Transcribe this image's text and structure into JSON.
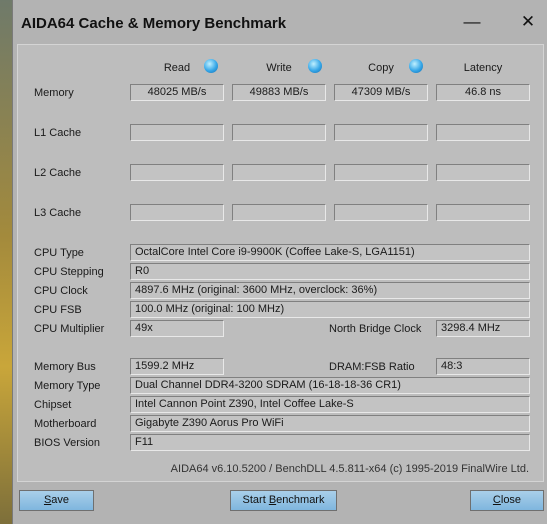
{
  "window": {
    "title": "AIDA64 Cache & Memory Benchmark",
    "minimize_glyph": "—",
    "close_glyph": "✕"
  },
  "columns": {
    "read": "Read",
    "write": "Write",
    "copy": "Copy",
    "latency": "Latency",
    "icon": "info-bubble-icon"
  },
  "rows": {
    "memory": {
      "label": "Memory",
      "read": "48025 MB/s",
      "write": "49883 MB/s",
      "copy": "47309 MB/s",
      "latency": "46.8 ns"
    },
    "l1": {
      "label": "L1 Cache"
    },
    "l2": {
      "label": "L2 Cache"
    },
    "l3": {
      "label": "L3 Cache"
    }
  },
  "cpu": {
    "type_label": "CPU Type",
    "type": "OctalCore Intel Core i9-9900K  (Coffee Lake-S, LGA1151)",
    "stepping_label": "CPU Stepping",
    "stepping": "R0",
    "clock_label": "CPU Clock",
    "clock": "4897.6 MHz  (original: 3600 MHz, overclock: 36%)",
    "fsb_label": "CPU FSB",
    "fsb": "100.0 MHz  (original: 100 MHz)",
    "multiplier_label": "CPU Multiplier",
    "multiplier": "49x",
    "nb_clock_label": "North Bridge Clock",
    "nb_clock": "3298.4 MHz"
  },
  "mem": {
    "bus_label": "Memory Bus",
    "bus": "1599.2 MHz",
    "ratio_label": "DRAM:FSB Ratio",
    "ratio": "48:3",
    "type_label": "Memory Type",
    "type": "Dual Channel DDR4-3200 SDRAM  (16-18-18-36 CR1)",
    "chipset_label": "Chipset",
    "chipset": "Intel Cannon Point Z390, Intel Coffee Lake-S",
    "motherboard_label": "Motherboard",
    "motherboard": "Gigabyte Z390 Aorus Pro WiFi",
    "bios_label": "BIOS Version",
    "bios": "F11"
  },
  "footer": "AIDA64 v6.10.5200 / BenchDLL 4.5.811-x64  (c) 1995-2019 FinalWire Ltd.",
  "buttons": {
    "save_first": "S",
    "save_rest": "ave",
    "start_pre": "Start ",
    "start_u": "B",
    "start_rest": "enchmark",
    "close_u": "C",
    "close_rest": "lose"
  }
}
